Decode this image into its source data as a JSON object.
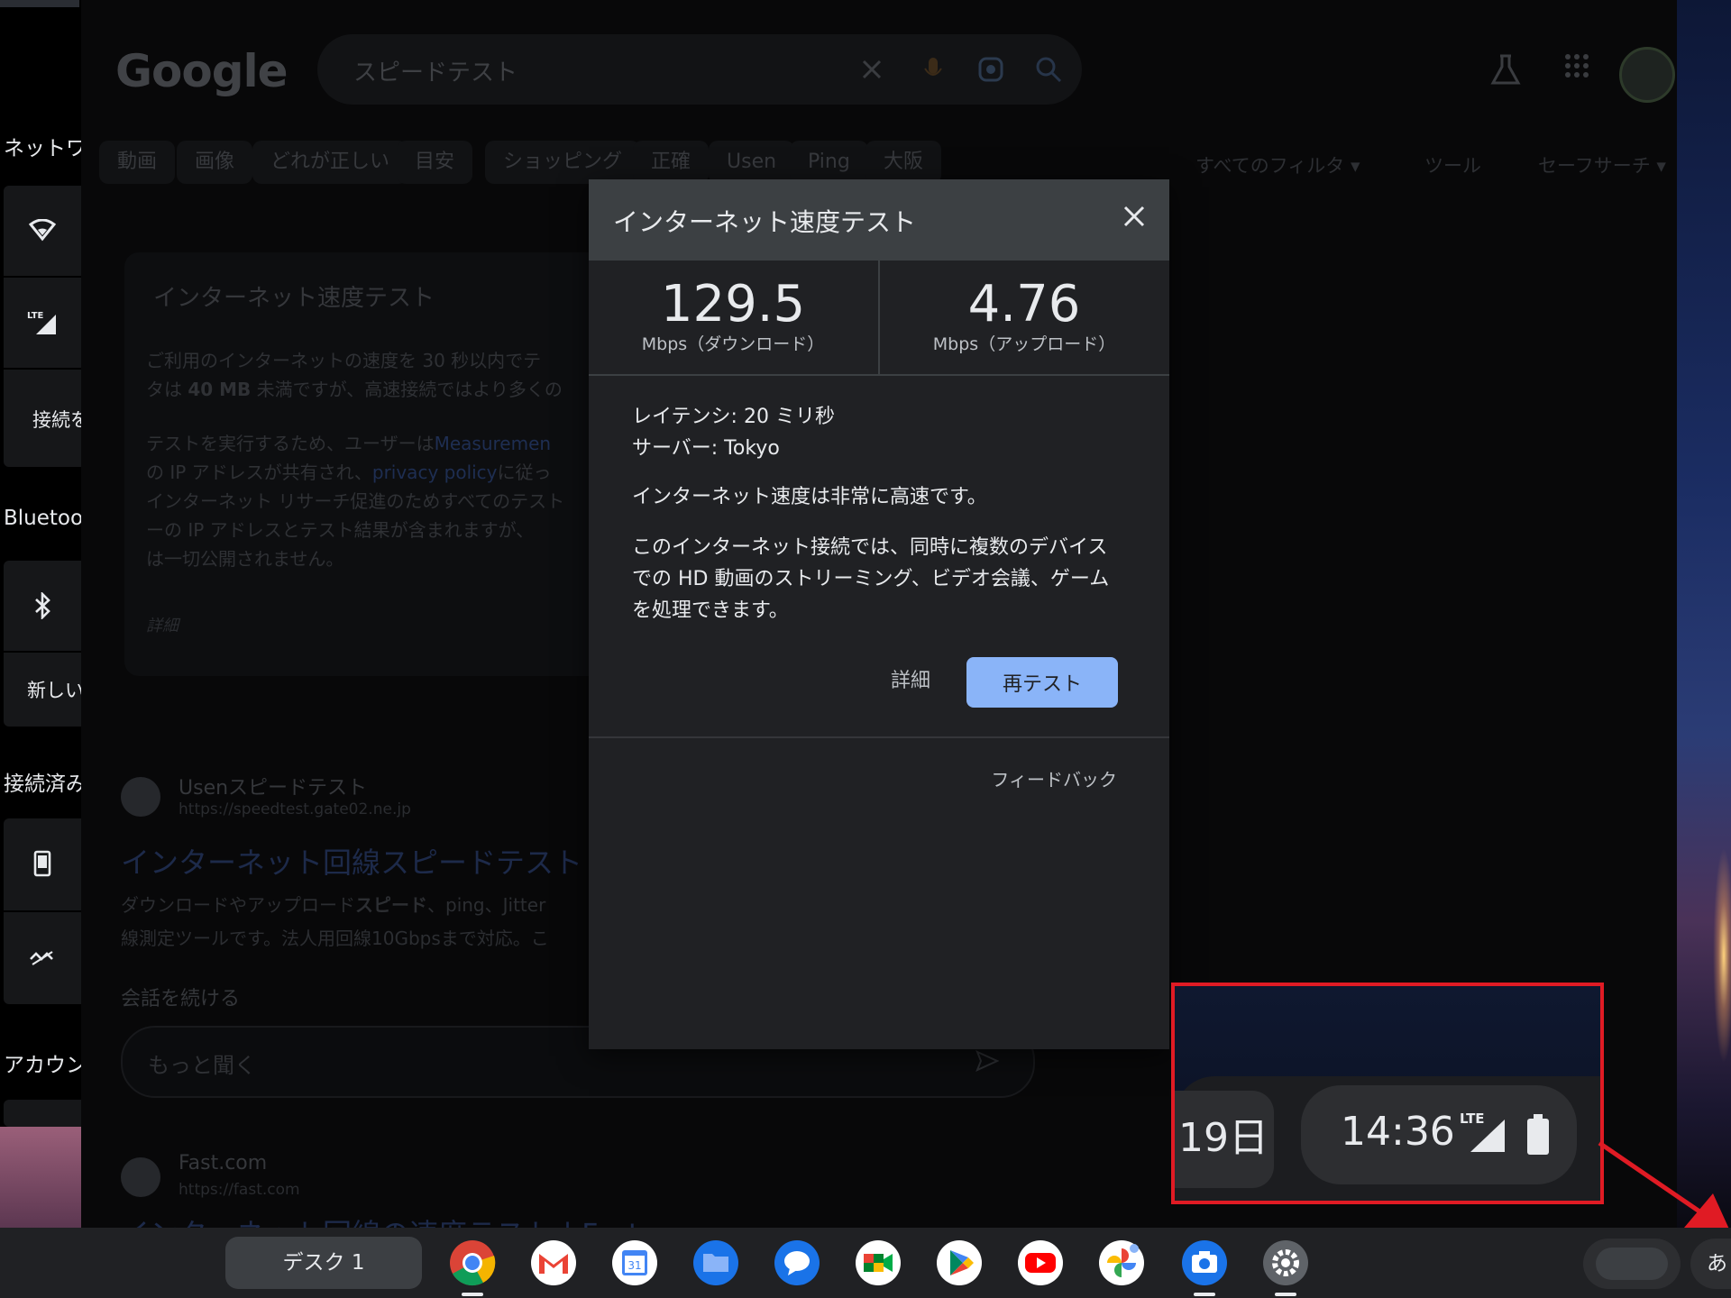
{
  "quick_settings": {
    "section_network": "ネットワ",
    "connect_label": "接続を",
    "section_bluetooth": "Bluetoot",
    "bluetooth_new_label": "新しい",
    "section_connected": "接続済み",
    "section_account": "アカウン",
    "lte_label": "LTE"
  },
  "browser": {
    "logo": "Google",
    "search_query": "スピードテスト",
    "filter_chips": [
      "動画",
      "画像",
      "どれが正しい",
      "目安",
      "ショッピング",
      "正確",
      "Usen",
      "Ping",
      "大阪"
    ],
    "all_filters_label": "すべてのフィルタ",
    "tools_label": "ツール",
    "safesearch_label": "セーフサーチ",
    "card_title": "インターネット速度テスト",
    "card_para1_a": "ご利用のインターネットの速度を 30 秒以内でテ",
    "card_para1_b": "タは",
    "card_para1_c": "40 MB",
    "card_para1_d": "未満ですが、高速接続ではより多くの",
    "card_para2_a": "テストを実行するため、ユーザーは",
    "card_para2_link": "Measuremen",
    "card_para2_b": "の IP アドレスが共有され、",
    "card_para2_link2": "privacy policy",
    "card_para2_c": "に従っ",
    "card_para2_d": "インターネット リサーチ促進のためすべてのテスト",
    "card_para2_e": "ーの IP アドレスとテスト結果が含まれますが、",
    "card_para2_f": "は一切公開されません。",
    "card_more": "詳細",
    "result1_site": "Usenスピードテスト",
    "result1_url": "https://speedtest.gate02.ne.jp",
    "result1_title": "インターネット回線スピードテスト",
    "result1_snippet_a": "ダウンロードやアップロード",
    "result1_snippet_b": "スピード",
    "result1_snippet_c": "、ping、Jitter",
    "result1_snippet_d": "線測定ツールです。法人用回線10Gbpsまで対応。こ",
    "convo_label": "会話を続ける",
    "convo_placeholder": "もっと聞く",
    "result2_site": "Fast.com",
    "result2_url": "https://fast.com",
    "result2_title": "インターネット回線の速度テスト | Fast"
  },
  "dialog": {
    "title": "インターネット速度テスト",
    "download_value": "129.5",
    "download_label": "Mbps（ダウンロード）",
    "upload_value": "4.76",
    "upload_label": "Mbps（アップロード）",
    "latency": "レイテンシ: 20 ミリ秒",
    "server": "サーバー: Tokyo",
    "verdict": "インターネット速度は非常に高速です。",
    "description": "このインターネット接続では、同時に複数のデバイスでの HD 動画のストリーミング、ビデオ会議、ゲームを処理できます。",
    "details_link": "詳細",
    "retest_button": "再テスト",
    "feedback_link": "フィードバック"
  },
  "status_zoom": {
    "date": "19日",
    "time": "14:36",
    "network": "LTE"
  },
  "shelf": {
    "desk_label": "デスク 1",
    "ime_label": "あ",
    "apps": [
      "chrome-icon",
      "gmail-icon",
      "calendar-icon",
      "files-icon",
      "messages-icon",
      "meet-icon",
      "play-store-icon",
      "youtube-icon",
      "photos-icon",
      "camera-icon",
      "settings-icon"
    ],
    "calendar_day": "31"
  },
  "colors": {
    "dialog_bg": "#202124",
    "dialog_header": "#3c4043",
    "accent_button": "#8ab4f8",
    "callout_red": "#e01b24"
  }
}
